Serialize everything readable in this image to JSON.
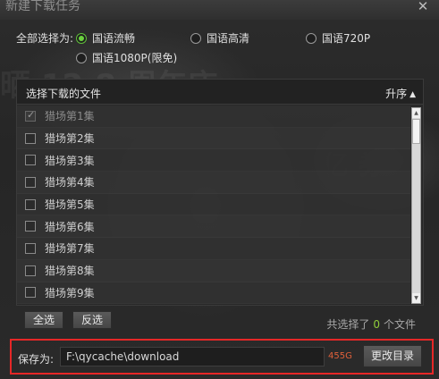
{
  "window": {
    "title": "新建下载任务",
    "close_icon": "close-icon"
  },
  "quality": {
    "label": "全部选择为:",
    "options": [
      {
        "label": "国语流畅",
        "checked": true
      },
      {
        "label": "国语高清",
        "checked": false
      },
      {
        "label": "国语720P",
        "checked": false
      },
      {
        "label": "国语1080P(限免)",
        "checked": false
      }
    ]
  },
  "files": {
    "header": "选择下载的文件",
    "sort_label": "升序",
    "sort_icon": "triangle-up-icon",
    "items": [
      {
        "label": "猎场第1集",
        "checked": true,
        "disabled": true
      },
      {
        "label": "猎场第2集",
        "checked": false
      },
      {
        "label": "猎场第3集",
        "checked": false
      },
      {
        "label": "猎场第4集",
        "checked": false
      },
      {
        "label": "猎场第5集",
        "checked": false
      },
      {
        "label": "猎场第6集",
        "checked": false
      },
      {
        "label": "猎场第7集",
        "checked": false
      },
      {
        "label": "猎场第8集",
        "checked": false
      },
      {
        "label": "猎场第9集",
        "checked": false
      }
    ]
  },
  "actions": {
    "select_all": "全选",
    "invert": "反选",
    "selected_prefix": "共选择了",
    "selected_count": "0",
    "selected_suffix": "个文件"
  },
  "save": {
    "label": "保存为:",
    "path": "F:\\qycache\\download",
    "free_space": "455G",
    "change_dir": "更改目录"
  },
  "colors": {
    "accent_green": "#6bd13f",
    "highlight_red": "#e62727",
    "free_space": "#e0603a"
  }
}
